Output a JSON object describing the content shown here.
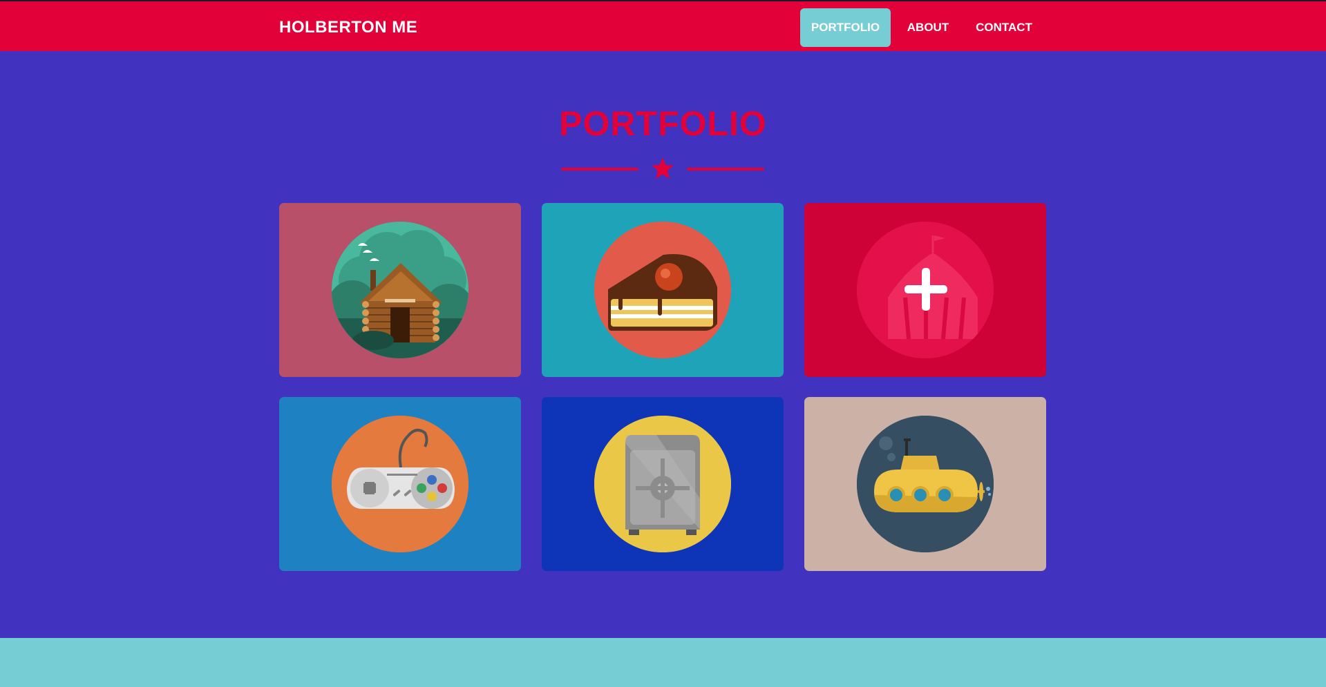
{
  "nav": {
    "brand": "HOLBERTON ME",
    "items": [
      "PORTFOLIO",
      "ABOUT",
      "CONTACT"
    ],
    "active": "PORTFOLIO"
  },
  "portfolio": {
    "title": "PORTFOLIO",
    "divider_icon": "star-icon"
  },
  "cards": [
    {
      "icon": "cabin-icon",
      "background": "#b85069",
      "circle": "#2f8f7a"
    },
    {
      "icon": "cake-icon",
      "background": "#1fa3b8",
      "circle": "#e25b4a"
    },
    {
      "icon": "circus-tent-icon",
      "background": "#ce0236",
      "circle": "#e3104a",
      "hover_overlay_icon": "plus-icon"
    },
    {
      "icon": "game-controller-icon",
      "background": "#1e82c2",
      "circle": "#e47a3e"
    },
    {
      "icon": "safe-icon",
      "background": "#0e35b8",
      "circle": "#ebc748"
    },
    {
      "icon": "submarine-icon",
      "background": "#cbb1a6",
      "circle": "#354e62"
    }
  ],
  "colors": {
    "navbar": "#e20138",
    "page_background": "#4133bf",
    "accent": "#e20138",
    "active_nav": "#76cdd3",
    "footer": "#76cdd3"
  }
}
